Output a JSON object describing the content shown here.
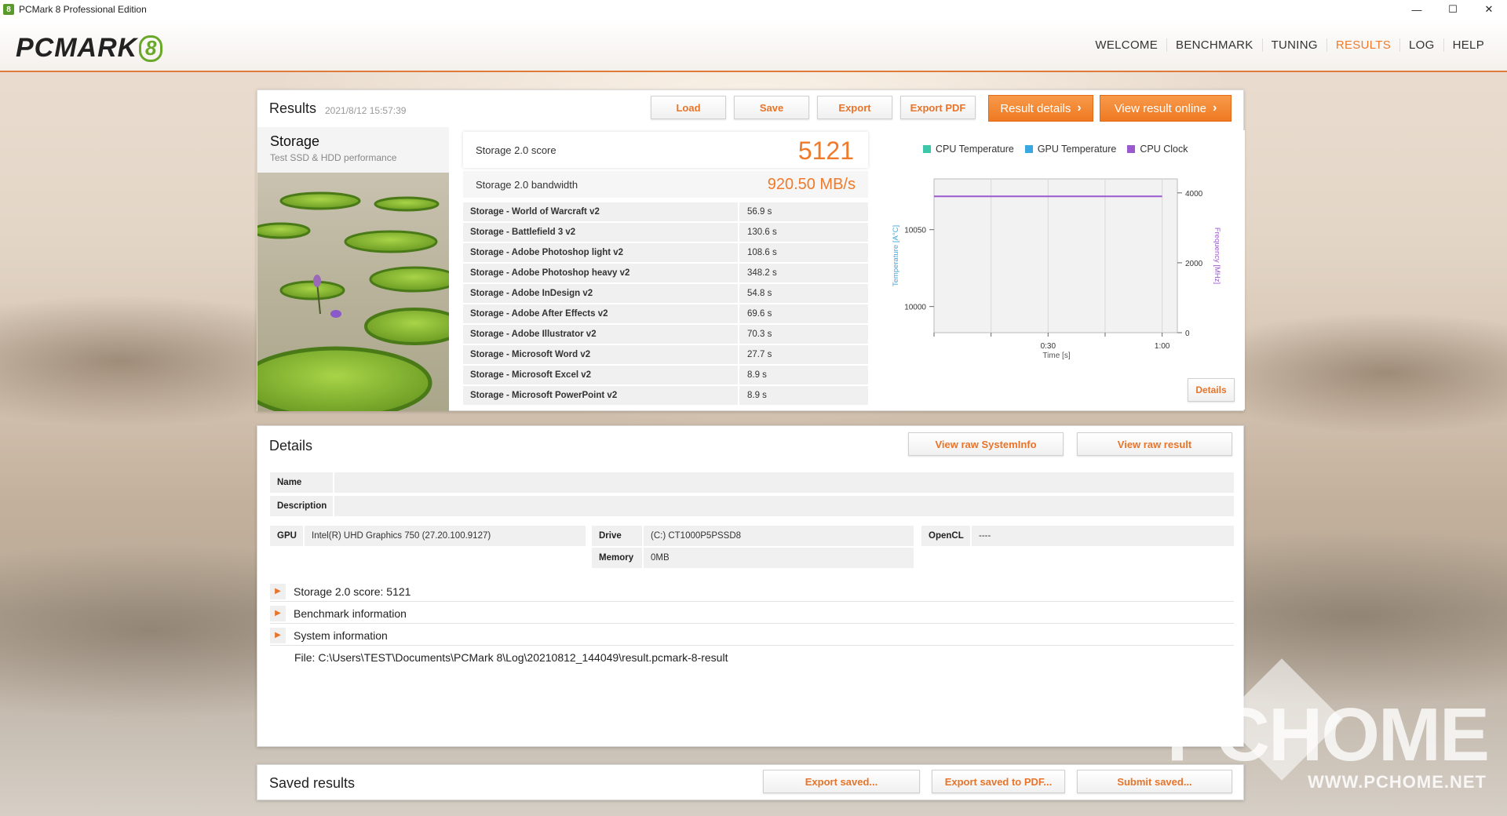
{
  "window": {
    "title": "PCMark 8 Professional Edition",
    "icon_text": "8",
    "controls": [
      "—",
      "☐",
      "✕"
    ]
  },
  "header": {
    "logo_text": "PCMARK",
    "logo_num": "8",
    "nav": [
      "WELCOME",
      "BENCHMARK",
      "TUNING",
      "RESULTS",
      "LOG",
      "HELP"
    ],
    "active_nav": "RESULTS"
  },
  "results": {
    "title": "Results",
    "timestamp": "2021/8/12 15:57:39",
    "buttons": [
      "Load",
      "Save",
      "Export",
      "Export PDF"
    ],
    "result_details": "Result details",
    "view_online": "View result online",
    "storage_name": "Storage",
    "storage_desc": "Test SSD & HDD performance",
    "score_label": "Storage 2.0 score",
    "score_value": "5121",
    "bandwidth_label": "Storage 2.0 bandwidth",
    "bandwidth_value": "920.50 MB/s",
    "tests": [
      {
        "name": "Storage - World of Warcraft v2",
        "value": "56.9 s"
      },
      {
        "name": "Storage - Battlefield 3 v2",
        "value": "130.6 s"
      },
      {
        "name": "Storage - Adobe Photoshop light v2",
        "value": "108.6 s"
      },
      {
        "name": "Storage - Adobe Photoshop heavy v2",
        "value": "348.2 s"
      },
      {
        "name": "Storage - Adobe InDesign v2",
        "value": "54.8 s"
      },
      {
        "name": "Storage - Adobe After Effects v2",
        "value": "69.6 s"
      },
      {
        "name": "Storage - Adobe Illustrator v2",
        "value": "70.3 s"
      },
      {
        "name": "Storage - Microsoft Word v2",
        "value": "27.7 s"
      },
      {
        "name": "Storage - Microsoft Excel v2",
        "value": "8.9 s"
      },
      {
        "name": "Storage - Microsoft PowerPoint v2",
        "value": "8.9 s"
      }
    ],
    "details_button": "Details"
  },
  "chart_data": {
    "type": "line",
    "legend": [
      {
        "name": "CPU Temperature",
        "color": "#3cc8a8"
      },
      {
        "name": "GPU Temperature",
        "color": "#3aa8e0"
      },
      {
        "name": "CPU Clock",
        "color": "#9a5acd"
      }
    ],
    "xlabel": "Time [s]",
    "x_ticks": [
      "0:30",
      "1:00"
    ],
    "ylabel_left": "Temperature [A°C]",
    "y_left_ticks": [
      "10050",
      "10000"
    ],
    "ylabel_right": "Frequency [MHz]",
    "y_right_ticks": [
      "4000",
      "2000",
      "0"
    ],
    "ylim_right": [
      0,
      4400
    ],
    "series": [
      {
        "name": "CPU Clock",
        "x": [
          0,
          60
        ],
        "values": [
          3900,
          3900
        ]
      }
    ]
  },
  "details": {
    "title": "Details",
    "view_sysinfo": "View raw SystemInfo",
    "view_raw_result": "View raw result",
    "name_label": "Name",
    "name_value": "",
    "description_label": "Description",
    "description_value": "",
    "gpu_label": "GPU",
    "gpu_value": "Intel(R) UHD Graphics 750 (27.20.100.9127)",
    "drive_label": "Drive",
    "drive_value": "(C:) CT1000P5PSSD8",
    "memory_label": "Memory",
    "memory_value": "0MB",
    "opencl_label": "OpenCL",
    "opencl_value": "----",
    "expanders": [
      "Storage 2.0 score: 5121",
      "Benchmark information",
      "System information"
    ],
    "file_path": "File: C:\\Users\\TEST\\Documents\\PCMark 8\\Log\\20210812_144049\\result.pcmark-8-result"
  },
  "saved": {
    "title": "Saved results",
    "buttons": [
      "Export saved...",
      "Export saved to PDF...",
      "Submit saved..."
    ]
  },
  "watermark": {
    "main": "PCHOME",
    "sub": "WWW.PCHOME.NET"
  }
}
